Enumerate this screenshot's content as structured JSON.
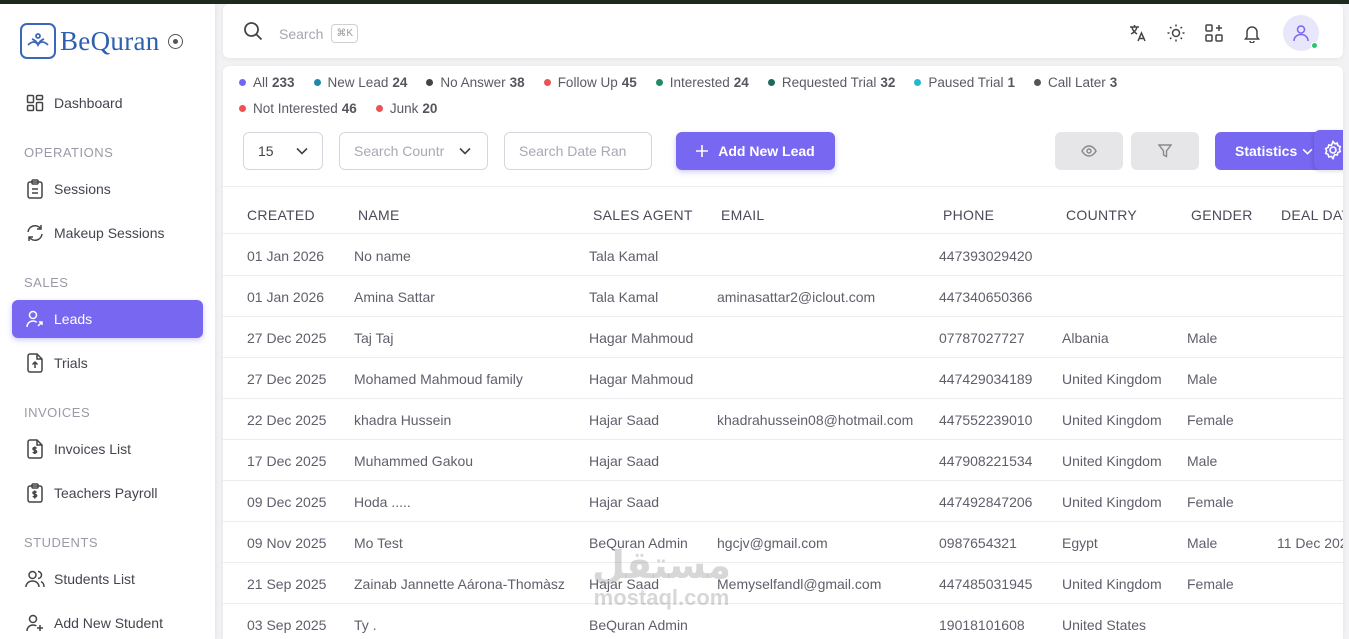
{
  "brand": {
    "name": "BeQuran"
  },
  "sidebar": {
    "dashboard": "Dashboard",
    "sections": [
      "OPERATIONS",
      "SALES",
      "INVOICES",
      "STUDENTS"
    ],
    "items": [
      {
        "label": "Sessions",
        "icon": "clipboard-icon"
      },
      {
        "label": "Makeup Sessions",
        "icon": "refresh-icon"
      },
      {
        "label": "Leads",
        "icon": "user-arrow-icon",
        "active": true
      },
      {
        "label": "Trials",
        "icon": "file-upload-icon"
      },
      {
        "label": "Invoices List",
        "icon": "invoice-dollar-icon"
      },
      {
        "label": "Teachers Payroll",
        "icon": "payroll-dollar-icon"
      },
      {
        "label": "Students List",
        "icon": "users-icon"
      },
      {
        "label": "Add New Student",
        "icon": "user-plus-icon"
      }
    ]
  },
  "topbar": {
    "search_placeholder": "Search",
    "shortcut": "⌘K"
  },
  "filters": [
    {
      "label": "All",
      "count": "233",
      "color": "#7367f0"
    },
    {
      "label": "New Lead",
      "count": "24",
      "color": "#1e88a8"
    },
    {
      "label": "No Answer",
      "count": "38",
      "color": "#444444"
    },
    {
      "label": "Follow Up",
      "count": "45",
      "color": "#ea5455"
    },
    {
      "label": "Interested",
      "count": "24",
      "color": "#1e8a6a"
    },
    {
      "label": "Requested Trial",
      "count": "32",
      "color": "#1f6b5a"
    },
    {
      "label": "Paused Trial",
      "count": "1",
      "color": "#22b8cf"
    },
    {
      "label": "Call Later",
      "count": "3",
      "color": "#555555"
    },
    {
      "label": "Not Interested",
      "count": "46",
      "color": "#ea5455"
    },
    {
      "label": "Junk",
      "count": "20",
      "color": "#ea5455"
    }
  ],
  "controls": {
    "per_page": "15",
    "country_placeholder": "Search Countr",
    "date_placeholder": "Search Date Ran",
    "add_lead": "Add New Lead",
    "statistics": "Statistics"
  },
  "table": {
    "columns": [
      "CREATED",
      "NAME",
      "SALES AGENT",
      "EMAIL",
      "PHONE",
      "COUNTRY",
      "GENDER",
      "DEAL DAT"
    ],
    "rows": [
      [
        "01 Jan 2026",
        "No name",
        "Tala Kamal",
        "",
        "447393029420",
        "",
        "",
        ""
      ],
      [
        "01 Jan 2026",
        "Amina Sattar",
        "Tala Kamal",
        "aminasattar2@iclout.com",
        "447340650366",
        "",
        "",
        ""
      ],
      [
        "27 Dec 2025",
        "Taj Taj",
        "Hagar Mahmoud",
        "",
        "07787027727",
        "Albania",
        "Male",
        ""
      ],
      [
        "27 Dec 2025",
        "Mohamed Mahmoud family",
        "Hagar Mahmoud",
        "",
        "447429034189",
        "United Kingdom",
        "Male",
        ""
      ],
      [
        "22 Dec 2025",
        "khadra Hussein",
        "Hajar Saad",
        "khadrahussein08@hotmail.com",
        "447552239010",
        "United Kingdom",
        "Female",
        ""
      ],
      [
        "17 Dec 2025",
        "Muhammed Gakou",
        "Hajar Saad",
        "",
        "447908221534",
        "United Kingdom",
        "Male",
        ""
      ],
      [
        "09 Dec 2025",
        "Hoda .....",
        "Hajar Saad",
        "",
        "447492847206",
        "United Kingdom",
        "Female",
        ""
      ],
      [
        "09 Nov 2025",
        "Mo Test",
        "BeQuran Admin",
        "hgcjv@gmail.com",
        "0987654321",
        "Egypt",
        "Male",
        "11 Dec 202"
      ],
      [
        "21 Sep 2025",
        "Zainab Jannette Aárona-Thomàsz",
        "Hajar Saad",
        "Memyselfandl@gmail.com",
        "447485031945",
        "United Kingdom",
        "Female",
        ""
      ],
      [
        "03 Sep 2025",
        "Ty .",
        "BeQuran Admin",
        "",
        "19018101608",
        "United States",
        "",
        ""
      ]
    ]
  },
  "watermark": {
    "arabic": "مستقل",
    "latin": "mostaql.com"
  }
}
